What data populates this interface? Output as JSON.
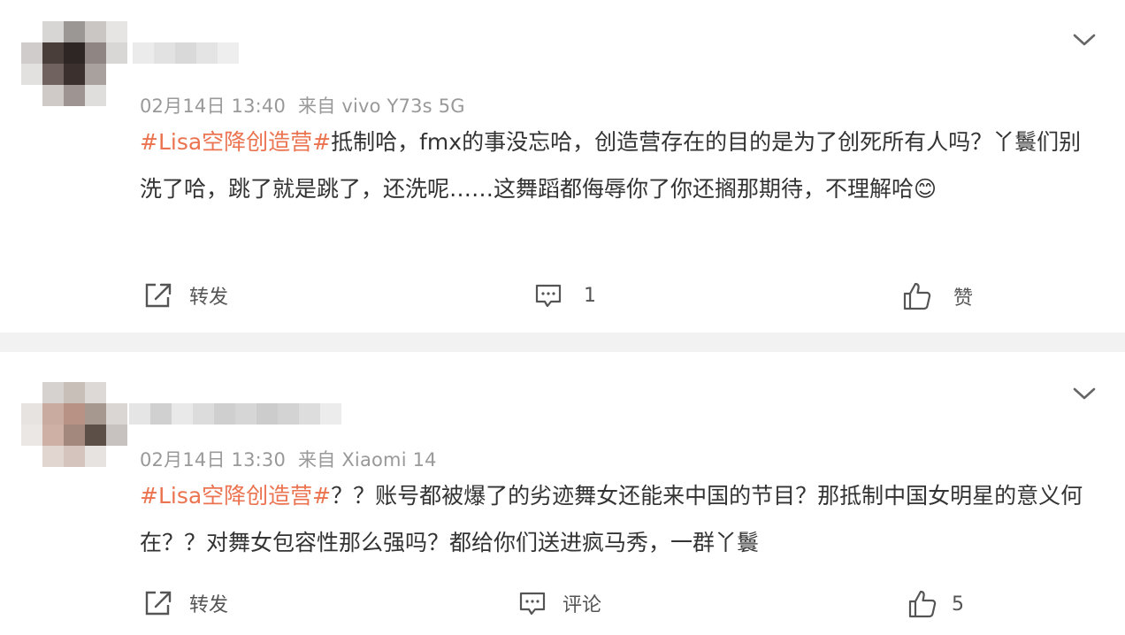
{
  "posts": [
    {
      "time": "02月14日 13:40",
      "source": "来自 vivo Y73s 5G",
      "topic": "#Lisa空降创造营#",
      "text": "抵制哈，fmx的事没忘哈，创造营存在的目的是为了创死所有人吗？丫鬟们别洗了哈，跳了就是跳了，还洗呢……这舞蹈都侮辱你了你还搁那期待，不理解哈😊",
      "repost_label": "转发",
      "comment_label": "1",
      "like_label": "赞"
    },
    {
      "time": "02月14日 13:30",
      "source": "来自 Xiaomi 14",
      "topic": "#Lisa空降创造营#",
      "text": "？？账号都被爆了的劣迹舞女还能来中国的节目？那抵制中国女明星的意义何在？？对舞女包容性那么强吗？都给你们送进疯马秀，一群丫鬟",
      "repost_label": "转发",
      "comment_label": "评论",
      "like_label": "5"
    }
  ],
  "icons": {
    "repost": "repost-icon",
    "comment": "comment-icon",
    "like": "like-icon",
    "menu": "chevron-down-icon"
  },
  "colors": {
    "topic": "#eb7350",
    "meta": "#999999",
    "divider": "#f2f2f2"
  }
}
